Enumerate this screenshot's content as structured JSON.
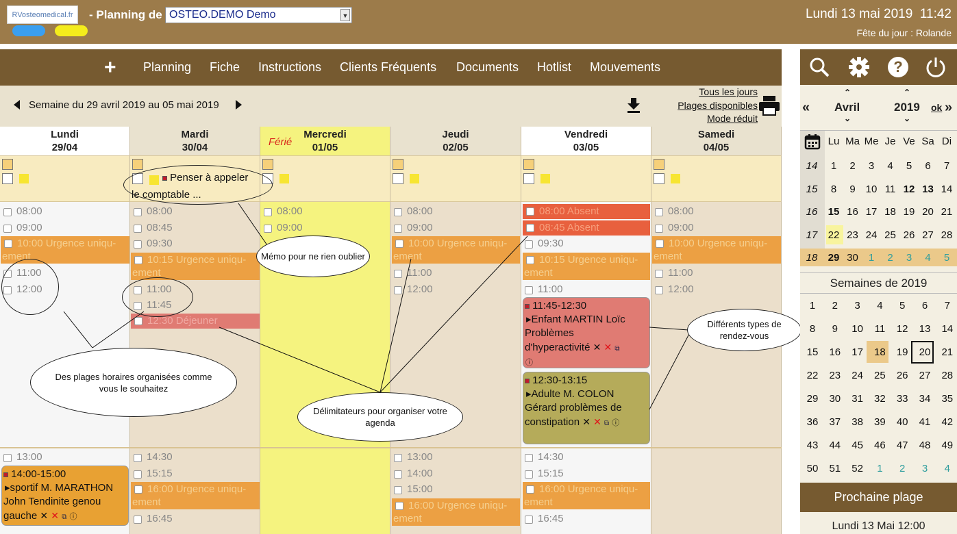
{
  "header": {
    "logo": "RVosteomedical.fr",
    "planning_label": "- Planning de",
    "planning_value": "OSTEO.DEMO Demo",
    "date": "Lundi 13 mai 2019",
    "time": "11:42",
    "fete": "Fête du jour : Rolande",
    "pill_colors": [
      "#3a9ff0",
      "#f4ec1c"
    ]
  },
  "menu": {
    "add": "+",
    "items": [
      "Planning",
      "Fiche",
      "Instructions",
      "Clients Fréquents",
      "Documents",
      "Hotlist",
      "Mouvements"
    ]
  },
  "week": {
    "label": "Semaine du 29 avril 2019 au 05 mai 2019",
    "links": [
      "Tous les jours",
      "Plages disponibles",
      "Mode réduit"
    ]
  },
  "days": [
    {
      "name": "Lundi",
      "date": "29/04"
    },
    {
      "name": "Mardi",
      "date": "30/04"
    },
    {
      "name": "Mercredi",
      "date": "01/05",
      "badge": "Férié"
    },
    {
      "name": "Jeudi",
      "date": "02/05"
    },
    {
      "name": "Vendredi",
      "date": "03/05"
    },
    {
      "name": "Samedi",
      "date": "04/05"
    }
  ],
  "memo": {
    "text1": "Penser à appeler",
    "text2": "le comptable ..."
  },
  "slots": {
    "lundi": [
      "08:00",
      "09:00",
      "10:00 Urgence uniqu-",
      "ement",
      "11:00",
      "12:00",
      "13:00"
    ],
    "mardi": [
      "08:00",
      "08:45",
      "09:30",
      "10:15 Urgence uniqu-",
      "ement",
      "11:00",
      "11:45",
      "12:30 Déjeuner",
      "14:30",
      "15:15",
      "16:00 Urgence uniqu-",
      "ement",
      "16:45"
    ],
    "mercredi": [
      "08:00",
      "09:00"
    ],
    "jeudi": [
      "08:00",
      "09:00",
      "10:00 Urgence uniqu-",
      "ement",
      "11:00",
      "12:00",
      "13:00",
      "14:00",
      "15:00",
      "16:00 Urgence uniqu-",
      "ement"
    ],
    "vendredi": [
      "08:00 Absent",
      "08:45 Absent",
      "09:30",
      "10:15 Urgence uniqu-",
      "ement",
      "11:00",
      "14:30",
      "15:15",
      "16:00 Urgence uniqu-",
      "ement",
      "16:45"
    ],
    "samedi": [
      "08:00",
      "09:00",
      "10:00 Urgence uniqu-",
      "ement",
      "11:00",
      "12:00"
    ]
  },
  "appointments": [
    {
      "time": "11:45-12:30",
      "line1": "Enfant MARTIN Loïc",
      "line2": "Problèmes",
      "line3": "d'hyperactivité",
      "color": "#e07b73"
    },
    {
      "time": "12:30-13:15",
      "line1": "Adulte M. COLON",
      "line2": "Gérard problèmes de",
      "line3": "constipation",
      "color": "#b5ab5a"
    },
    {
      "time": "14:00-15:00",
      "line1": "sportif M. MARATHON",
      "line2": "John Tendinite genou",
      "line3": "gauche",
      "color": "#e8a133"
    }
  ],
  "annotations": {
    "memo": "Mémo pour ne rien oublier",
    "plages": "Des plages horaires organisées comme vous le souhaitez",
    "delim": "Délimitateurs pour organiser votre agenda",
    "types": "Différents types de rendez-vous"
  },
  "sidebar": {
    "month": "Avril",
    "year": "2019",
    "ok": "ok",
    "weekdays": [
      "Lu",
      "Ma",
      "Me",
      "Je",
      "Ve",
      "Sa",
      "Di"
    ],
    "weeks": [
      {
        "w": "14",
        "d": [
          "1",
          "2",
          "3",
          "4",
          "5",
          "6",
          "7"
        ]
      },
      {
        "w": "15",
        "d": [
          "8",
          "9",
          "10",
          "11",
          "12",
          "13",
          "14"
        ]
      },
      {
        "w": "16",
        "d": [
          "15",
          "16",
          "17",
          "18",
          "19",
          "20",
          "21"
        ]
      },
      {
        "w": "17",
        "d": [
          "22",
          "23",
          "24",
          "25",
          "26",
          "27",
          "28"
        ]
      },
      {
        "w": "18",
        "d": [
          "29",
          "30",
          "1",
          "2",
          "3",
          "4",
          "5"
        ]
      }
    ],
    "weeks_title": "Semaines de 2019",
    "week_numbers": [
      [
        "1",
        "2",
        "3",
        "4",
        "5",
        "6",
        "7"
      ],
      [
        "8",
        "9",
        "10",
        "11",
        "12",
        "13",
        "14"
      ],
      [
        "15",
        "16",
        "17",
        "18",
        "19",
        "20",
        "21"
      ],
      [
        "22",
        "23",
        "24",
        "25",
        "26",
        "27",
        "28"
      ],
      [
        "29",
        "30",
        "31",
        "32",
        "33",
        "34",
        "35"
      ],
      [
        "36",
        "37",
        "38",
        "39",
        "40",
        "41",
        "42"
      ],
      [
        "43",
        "44",
        "45",
        "46",
        "47",
        "48",
        "49"
      ],
      [
        "50",
        "51",
        "52",
        "1",
        "2",
        "3",
        "4"
      ]
    ],
    "next_label": "Prochaine plage",
    "next_value": "Lundi 13 Mai 12:00"
  }
}
